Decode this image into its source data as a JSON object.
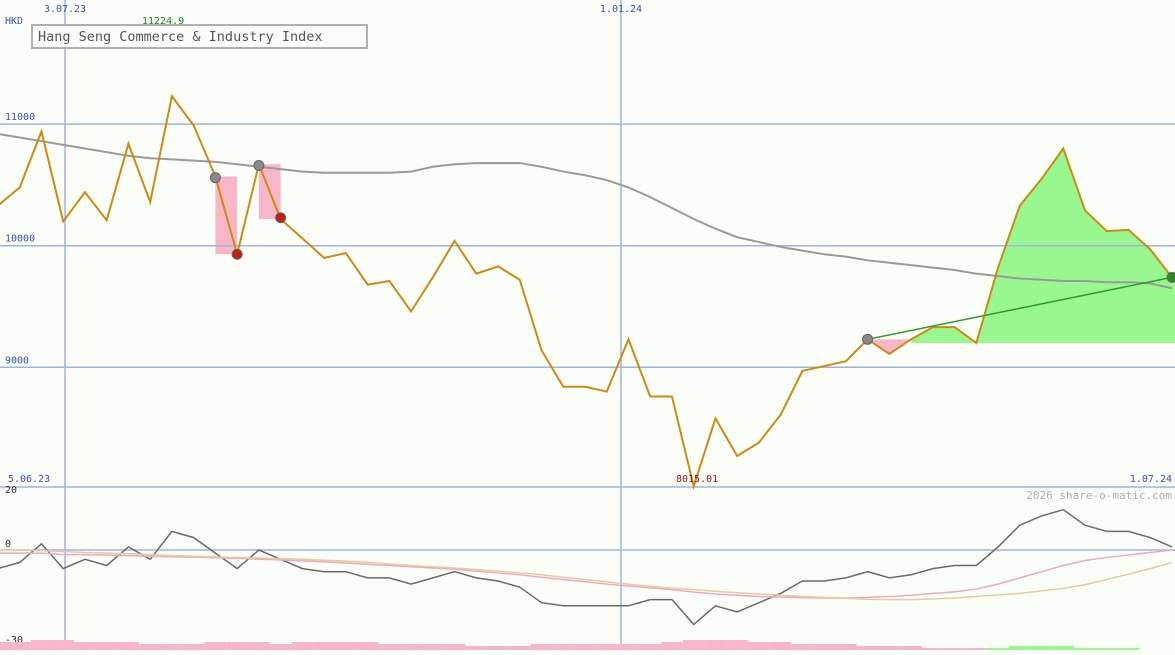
{
  "chart_data": [
    {
      "type": "line",
      "title": "Hang Seng Commerce & Industry Index",
      "currency_label": "HKD",
      "watermark": "2026 share-o-matic.com",
      "x_start_label": "5.06.23",
      "x_end_label": "1.07.24",
      "x_tick_labels": [
        "3.07.23",
        "1.01.24"
      ],
      "y_tick_labels": [
        "9000",
        "10000",
        "11000"
      ],
      "ylim": [
        8015,
        11225
      ],
      "max_label": "11224.9",
      "min_label": "8015.01",
      "colors": {
        "price": "#d08a10",
        "moving_average": "#9a9a9a",
        "trend_line": "#2a9a2a",
        "gain_fill": "#98f88f",
        "loss_fill": "#f8b7c9",
        "grid": "#9fb3e5",
        "axis_text": "#3a4ec0",
        "max_text": "#1a8a1a",
        "min_text": "#8a1a1a"
      },
      "series": [
        {
          "values": [
            10330,
            10480,
            10940,
            10200,
            10440,
            10210,
            10840,
            10360,
            11230,
            10990,
            10570,
            9930,
            10670,
            10220,
            10060,
            9900,
            9940,
            9680,
            9710,
            9460,
            9740,
            10040,
            9770,
            9830,
            9720,
            9140,
            8840,
            8840,
            8800,
            9230,
            8760,
            8760,
            8020,
            8580,
            8270,
            8380,
            8610,
            8970,
            9010,
            9050,
            9230,
            9110,
            9230,
            9330,
            9330,
            9200,
            9820,
            10330,
            10550,
            10800,
            10290,
            10120,
            10130,
            9970,
            9740
          ]
        },
        {
          "values": [
            10920,
            10890,
            10860,
            10830,
            10800,
            10770,
            10740,
            10720,
            10710,
            10700,
            10690,
            10670,
            10650,
            10630,
            10610,
            10600,
            10600,
            10600,
            10600,
            10610,
            10650,
            10670,
            10680,
            10680,
            10680,
            10650,
            10610,
            10580,
            10540,
            10480,
            10400,
            10310,
            10220,
            10140,
            10070,
            10030,
            9990,
            9960,
            9930,
            9910,
            9880,
            9860,
            9840,
            9820,
            9800,
            9770,
            9750,
            9730,
            9720,
            9710,
            9710,
            9700,
            9700,
            9690,
            9650
          ]
        }
      ],
      "signals": [
        {
          "type": "neutral",
          "index": 10,
          "value": 10560
        },
        {
          "type": "sell",
          "index": 11,
          "value": 9930
        },
        {
          "type": "neutral",
          "index": 12,
          "value": 10660
        },
        {
          "type": "sell",
          "index": 13,
          "value": 10230
        },
        {
          "type": "neutral",
          "index": 40,
          "value": 9230
        },
        {
          "type": "buy",
          "index": 54,
          "value": 9740
        }
      ],
      "oscillator": {
        "y_tick_labels": [
          "20",
          "0",
          "-30"
        ],
        "ylim": [
          -30,
          20
        ],
        "series": [
          {
            "color": "#6a6a6a",
            "values": [
              -6,
              -4,
              2,
              -6,
              -3,
              -5,
              1,
              -3,
              6,
              4,
              -1,
              -6,
              0,
              -3,
              -6,
              -7,
              -7,
              -9,
              -9,
              -11,
              -9,
              -7,
              -9,
              -10,
              -12,
              -17,
              -18,
              -18,
              -18,
              -18,
              -16,
              -16,
              -24,
              -18,
              -20,
              -17,
              -14,
              -10,
              -10,
              -9,
              -7,
              -9,
              -8,
              -6,
              -5,
              -5,
              1,
              8,
              11,
              13,
              8,
              6,
              6,
              4,
              1
            ]
          },
          {
            "color": "#f0a8c0",
            "values": [
              -1,
              -1,
              -1,
              -1.5,
              -1.5,
              -1.6,
              -1.8,
              -2,
              -2.2,
              -2.3,
              -2.5,
              -2.7,
              -3,
              -3.2,
              -3.5,
              -3.8,
              -4.2,
              -4.6,
              -5,
              -5.4,
              -5.8,
              -6.2,
              -6.8,
              -7.4,
              -8,
              -8.8,
              -9.5,
              -10.2,
              -11,
              -11.6,
              -12.2,
              -12.8,
              -13.6,
              -14.2,
              -14.6,
              -15,
              -15.2,
              -15.4,
              -15.5,
              -15.5,
              -15.3,
              -15,
              -14.6,
              -14,
              -13.5,
              -12.6,
              -11,
              -9,
              -7,
              -5,
              -3.4,
              -2.4,
              -1.6,
              -0.8,
              0
            ]
          },
          {
            "color": "#e5cba0",
            "values": [
              0,
              0,
              -0.2,
              -0.5,
              -0.8,
              -1,
              -1.2,
              -1.5,
              -1.8,
              -2,
              -2.2,
              -2.4,
              -2.6,
              -2.8,
              -3,
              -3.3,
              -3.6,
              -4,
              -4.5,
              -5,
              -5.4,
              -5.8,
              -6.3,
              -6.8,
              -7.4,
              -8,
              -8.8,
              -9.5,
              -10.3,
              -11,
              -11.7,
              -12.3,
              -12.8,
              -13.3,
              -13.8,
              -14.2,
              -14.6,
              -15,
              -15.3,
              -15.6,
              -15.9,
              -16,
              -16,
              -15.8,
              -15.5,
              -15,
              -14.5,
              -14,
              -13.2,
              -12.4,
              -11.2,
              -9.5,
              -7.8,
              -6,
              -4
            ]
          }
        ],
        "histogram": [
          -4,
          -4,
          -5,
          -5,
          -4,
          -4,
          -4,
          -3,
          -3,
          -3,
          -4,
          -4,
          -4,
          -3,
          -4,
          -4,
          -4,
          -4,
          -3,
          -3,
          -3,
          -3,
          -2,
          -2,
          -2,
          -3,
          -3,
          -3,
          -3,
          -3,
          -3,
          -4,
          -5,
          -5,
          -5,
          -4,
          -4,
          -3,
          -3,
          -3,
          -2,
          -2,
          -2,
          -1,
          -1,
          -1,
          1,
          2,
          2,
          2,
          1,
          1,
          1,
          0,
          0
        ],
        "histogram_colors": {
          "positive": "#98f88f",
          "negative": "#f8b7c9"
        }
      }
    }
  ]
}
